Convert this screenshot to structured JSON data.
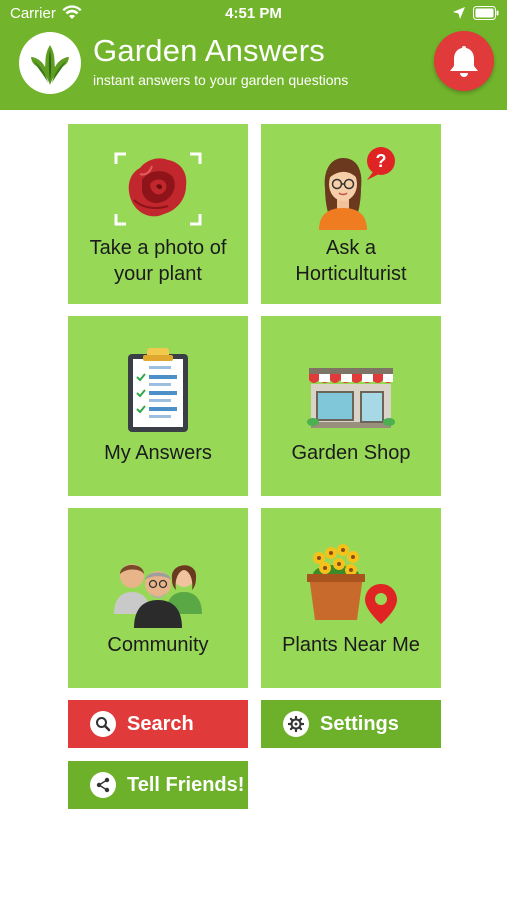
{
  "status_bar": {
    "carrier": "Carrier",
    "time": "4:51 PM"
  },
  "header": {
    "title": "Garden Answers",
    "subtitle": "instant answers to your garden questions"
  },
  "tiles": [
    {
      "label": "Take a photo of your plant",
      "icon": "rose-camera-icon"
    },
    {
      "label": "Ask a Horticulturist",
      "icon": "horticulturist-icon"
    },
    {
      "label": "My Answers",
      "icon": "clipboard-checklist-icon"
    },
    {
      "label": "Garden Shop",
      "icon": "shop-storefront-icon"
    },
    {
      "label": "Community",
      "icon": "people-group-icon"
    },
    {
      "label": "Plants Near Me",
      "icon": "flower-pot-location-icon"
    }
  ],
  "buttons": {
    "search": "Search",
    "settings": "Settings",
    "tell_friends": "Tell Friends!"
  },
  "colors": {
    "header_green": "#72b52c",
    "tile_green": "#97d957",
    "search_red": "#e03a3a",
    "settings_green": "#6db02a",
    "bell_red": "#e03a3a"
  }
}
